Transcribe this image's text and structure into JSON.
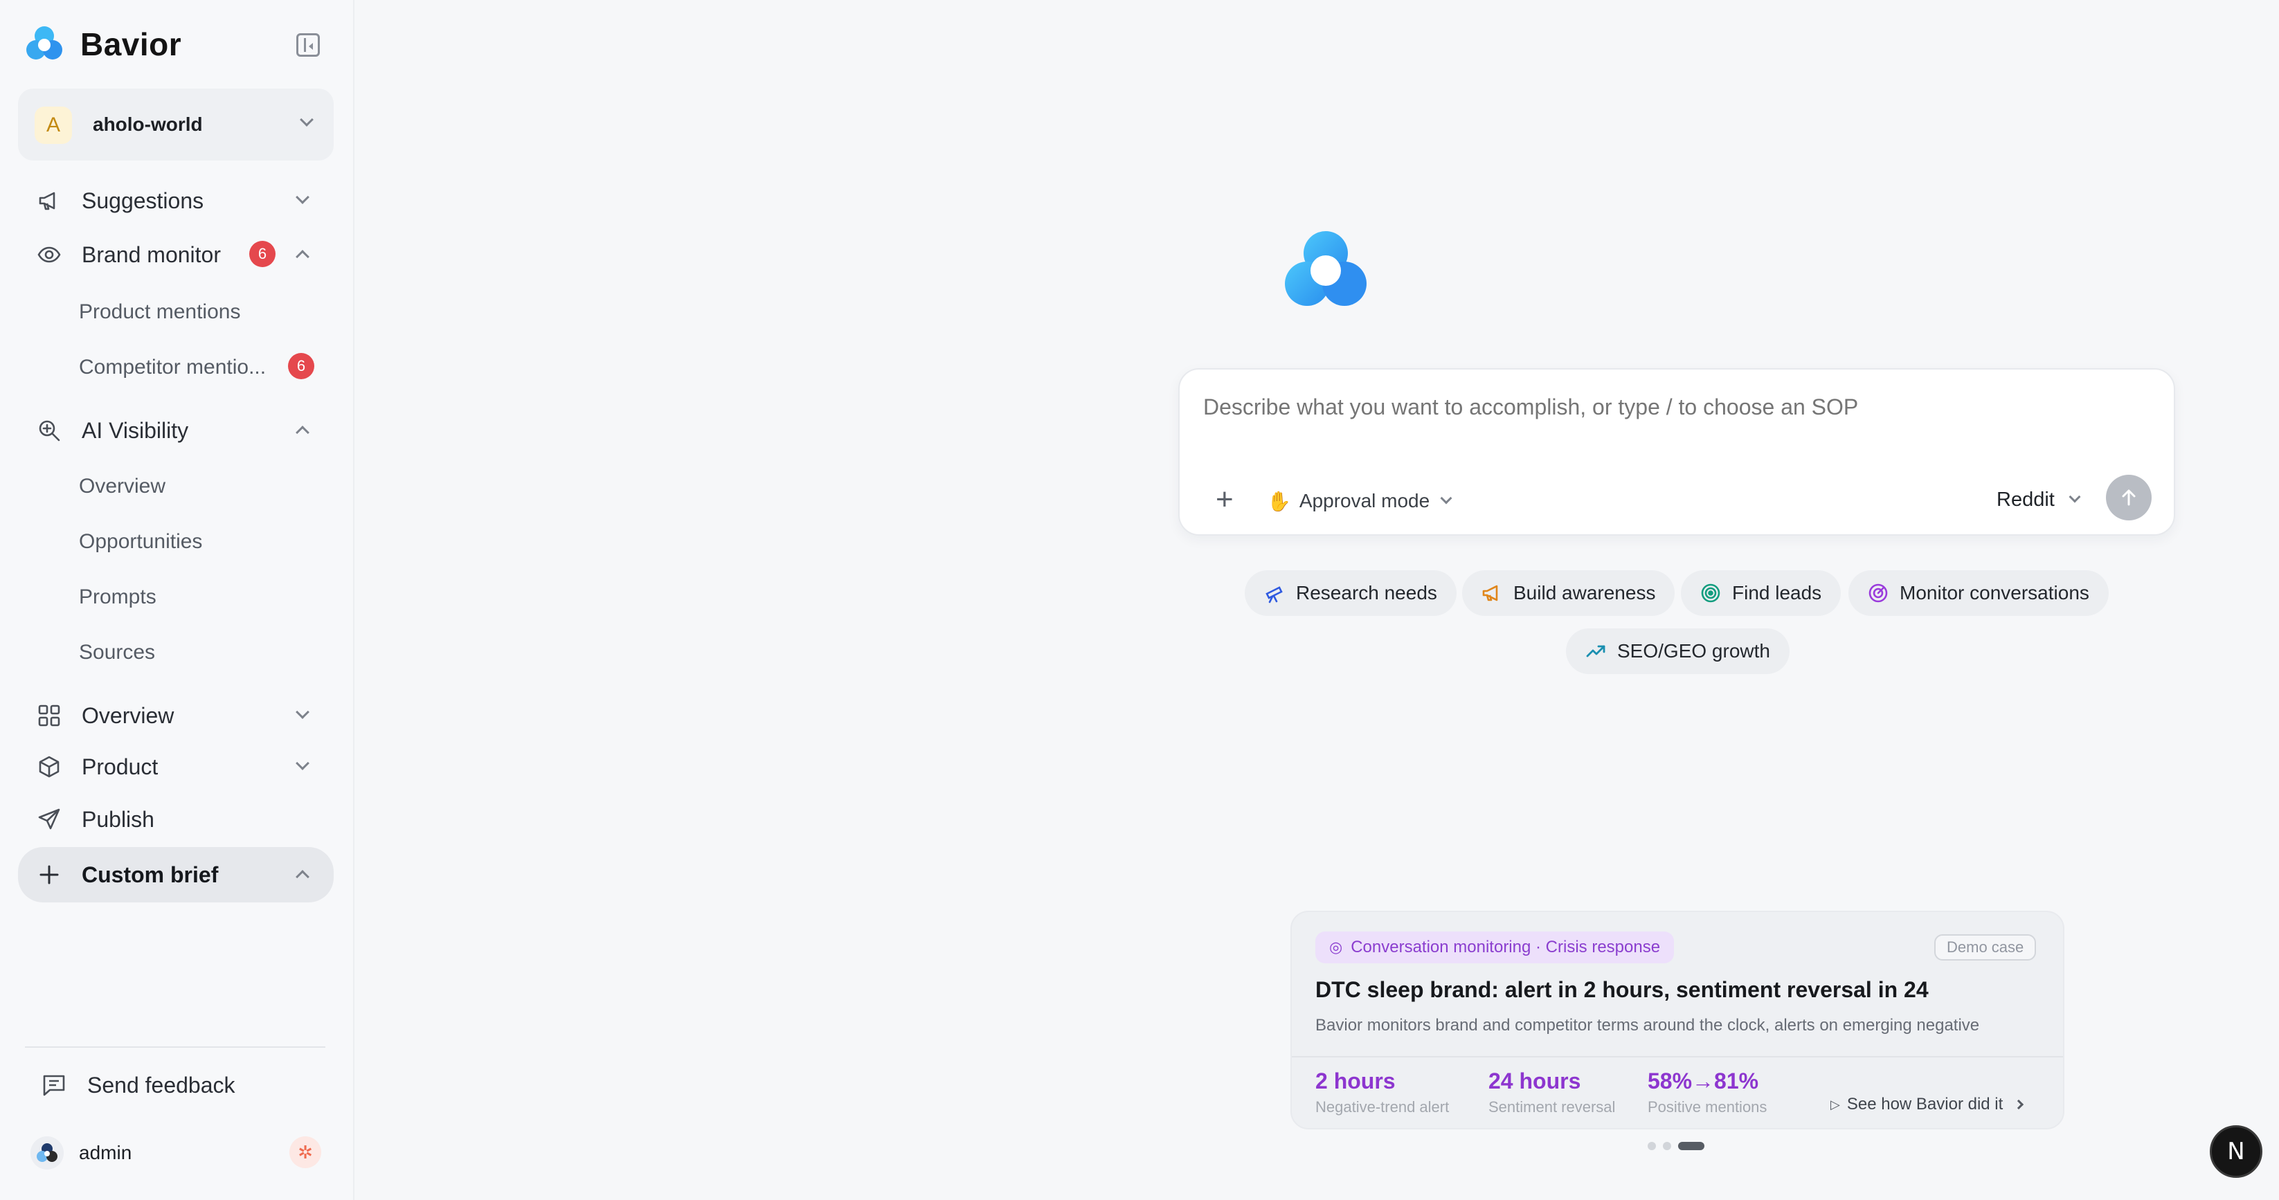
{
  "brand": {
    "name": "Bavior"
  },
  "workspace": {
    "initial": "A",
    "name": "aholo-world"
  },
  "nav": {
    "suggestions": "Suggestions",
    "brand_monitor": {
      "label": "Brand monitor",
      "badge": "6"
    },
    "product_mentions": "Product mentions",
    "competitor_mentions": {
      "label": "Competitor mentio...",
      "badge": "6"
    },
    "ai_visibility": "AI Visibility",
    "ai_overview": "Overview",
    "opportunities": "Opportunities",
    "prompts": "Prompts",
    "sources": "Sources",
    "overview": "Overview",
    "product": "Product",
    "publish": "Publish",
    "custom_brief": "Custom brief"
  },
  "footer": {
    "feedback": "Send feedback",
    "user": "admin"
  },
  "composer": {
    "placeholder": "Describe what you want to accomplish, or type / to choose an SOP",
    "approval_mode": "Approval mode",
    "platform": "Reddit"
  },
  "chips": [
    {
      "label": "Research needs",
      "icon": "telescope-icon",
      "color": "#2f5ae0"
    },
    {
      "label": "Build awareness",
      "icon": "megaphone-icon",
      "color": "#e0861b"
    },
    {
      "label": "Find leads",
      "icon": "target-icon",
      "color": "#129d7f"
    },
    {
      "label": "Monitor conversations",
      "icon": "radar-icon",
      "color": "#9a3bdc"
    },
    {
      "label": "SEO/GEO growth",
      "icon": "trend-up-icon",
      "color": "#1a8fb0"
    }
  ],
  "case": {
    "tag": "Conversation monitoring · Crisis response",
    "demo_label": "Demo case",
    "title": "DTC sleep brand: alert in 2 hours, sentiment reversal in 24",
    "description": "Bavior monitors brand and competitor terms around the clock, alerts on emerging negative",
    "stats": [
      {
        "value": "2 hours",
        "label": "Negative-trend alert"
      },
      {
        "value": "24 hours",
        "label": "Sentiment reversal"
      },
      {
        "value": "58%→81%",
        "label": "Positive mentions"
      }
    ],
    "cta": "See how Bavior did it",
    "carousel_active_index": 2,
    "carousel_count": 3
  },
  "colors": {
    "accent_purple": "#8d36cf",
    "badge_red": "#e5484d",
    "logo_blue": "#2aa3f0"
  }
}
